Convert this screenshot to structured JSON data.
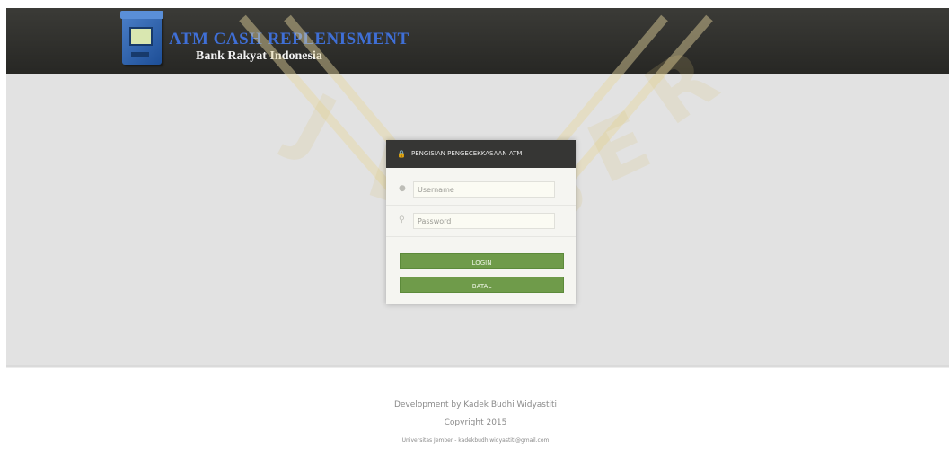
{
  "header": {
    "app_title": "ATM CASH REPLENISMENT",
    "app_subtitle": "Bank Rakyat Indonesia",
    "logo_icon": "atm-machine-icon"
  },
  "login_panel": {
    "title": "PENGISIAN PENGECEKKASAAN ATM",
    "lock_icon": "lock-icon",
    "username_placeholder": "Username",
    "username_icon": "user-icon",
    "password_placeholder": "Password",
    "password_icon": "key-icon",
    "login_label": "LOGIN",
    "cancel_label": "BATAL"
  },
  "footer": {
    "developer": "Development by Kadek Budhi Widyastiti",
    "copyright": "Copyright 2015",
    "contact": "Universitas Jember - kadekbudhiwidyastiti@gmail.com"
  },
  "colors": {
    "header_bg": "#2f2f2c",
    "title_blue": "#3f6fd6",
    "button_green": "#6f9b4a",
    "content_bg": "#e2e2e2"
  }
}
